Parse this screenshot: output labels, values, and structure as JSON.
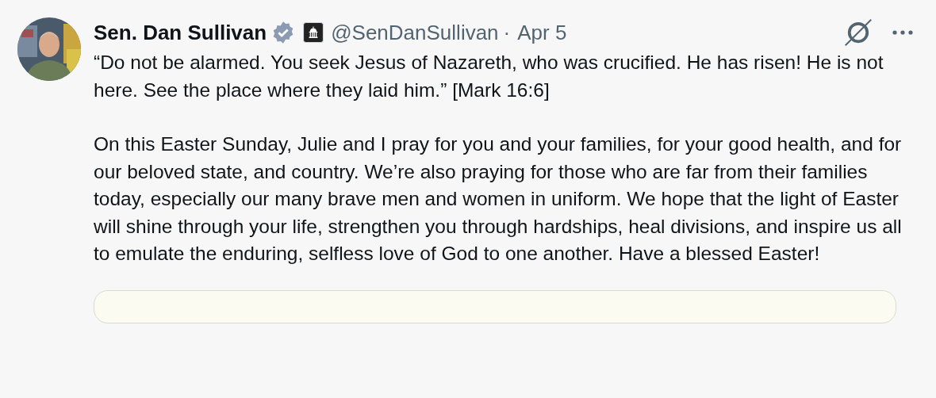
{
  "author": {
    "name": "Sen. Dan Sullivan",
    "verified": true,
    "handle": "@SenDanSullivan",
    "separator": "·",
    "date": "Apr 5"
  },
  "paragraphs": [
    "“Do not be alarmed. You seek Jesus of Nazareth, who was crucified. He has risen! He is not here. See the place where they laid him.” [Mark 16:6]",
    "On this Easter Sunday, Julie and I pray for you and your families, for your good health, and for our beloved state, and country. We’re also praying for those who are far from their families today, especially our many brave men and women in uniform. We hope that the light of Easter will shine through your life, strengthen you through hardships, heal divisions, and inspire us all to emulate the enduring, selfless love of God to one another. Have a blessed Easter!"
  ]
}
